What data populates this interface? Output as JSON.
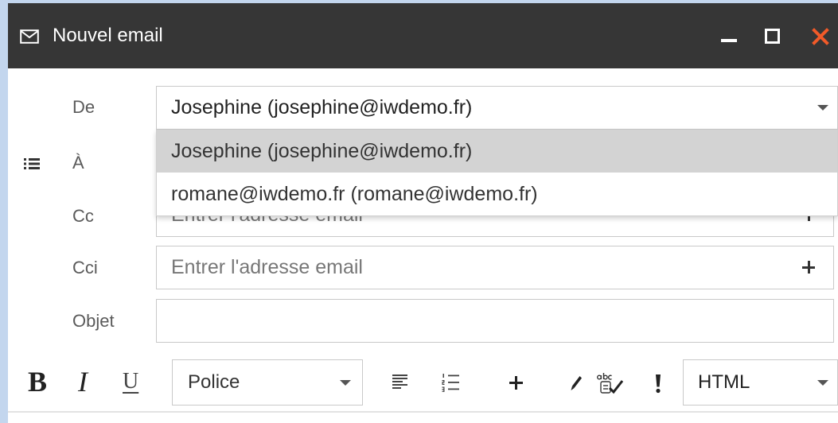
{
  "window": {
    "title": "Nouvel email",
    "title_icon": "envelope-icon",
    "minimize_icon": "minimize-icon",
    "maximize_icon": "maximize-icon",
    "close_icon": "close-icon"
  },
  "form": {
    "from": {
      "label": "De",
      "selected": "Josephine (josephine@iwdemo.fr)",
      "dropdown_open": true,
      "options": [
        "Josephine (josephine@iwdemo.fr)",
        "romane@iwdemo.fr (romane@iwdemo.fr)"
      ],
      "highlighted_index": 0,
      "caret_icon": "chevron-down-icon"
    },
    "to": {
      "label": "À",
      "contacts_icon": "contacts-list-icon"
    },
    "cc": {
      "label": "Cc",
      "placeholder": "Entrer l'adresse email",
      "add_icon": "plus-icon"
    },
    "bcc": {
      "label": "Cci",
      "placeholder": "Entrer l'adresse email",
      "add_icon": "plus-icon"
    },
    "subject": {
      "label": "Objet",
      "value": ""
    }
  },
  "toolbar": {
    "bold_label": "B",
    "italic_label": "I",
    "underline_label": "U",
    "font_select": {
      "value": "Police",
      "caret_icon": "chevron-down-icon"
    },
    "icons": [
      "align-left-icon",
      "numbered-list-icon",
      "insert-plus-icon",
      "pen-icon",
      "spellcheck-icon",
      "important-icon"
    ],
    "format_select": {
      "value": "HTML",
      "caret_icon": "chevron-down-icon"
    }
  },
  "colors": {
    "page_bg": "#c3d6ee",
    "titlebar_bg": "#363636",
    "close_icon": "#f15a29",
    "highlighted_option_bg": "#d3d3d3"
  }
}
